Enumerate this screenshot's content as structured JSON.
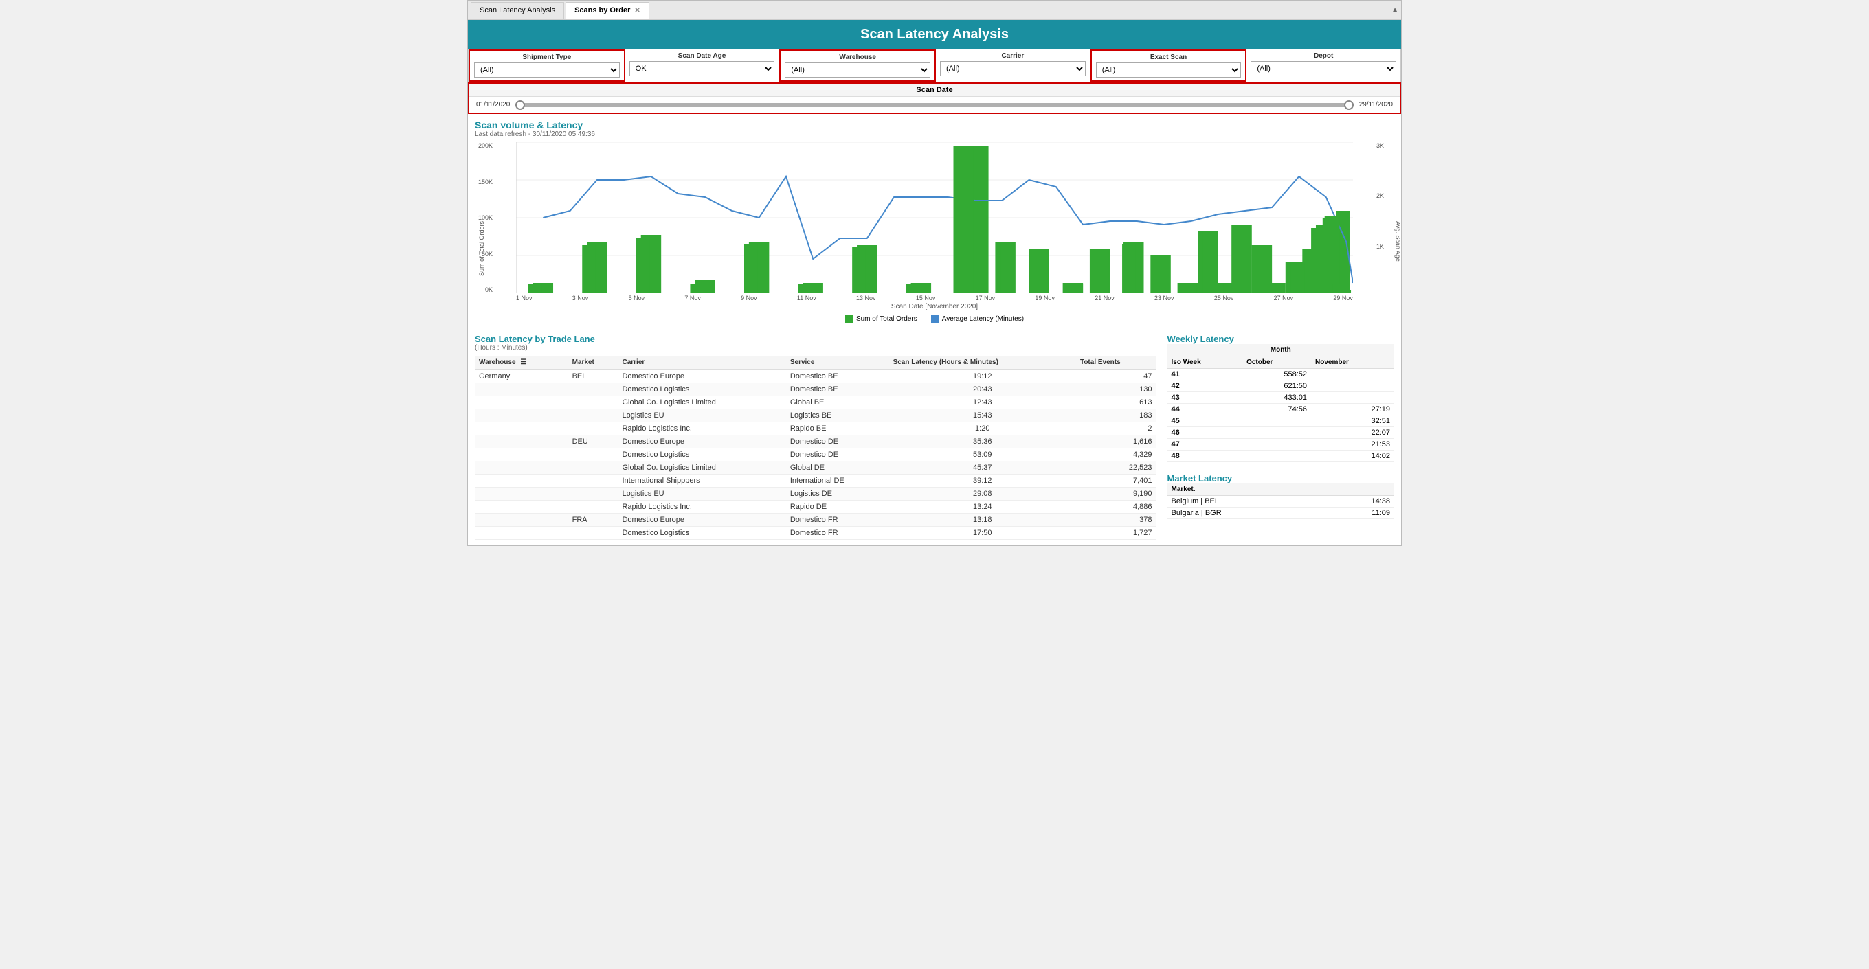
{
  "tabs": {
    "items": [
      {
        "label": "Scan Latency Analysis",
        "active": false
      },
      {
        "label": "Scans by Order",
        "active": true
      }
    ]
  },
  "header": {
    "title": "Scan Latency Analysis"
  },
  "filters": {
    "shipment_type": {
      "label": "Shipment Type",
      "value": "(All)",
      "options": [
        "(All)"
      ]
    },
    "scan_date_age": {
      "label": "Scan Date Age",
      "value": "OK",
      "options": [
        "OK"
      ]
    },
    "warehouse": {
      "label": "Warehouse",
      "value": "(All)",
      "options": [
        "(All)"
      ]
    },
    "carrier": {
      "label": "Carrier",
      "value": "(All)",
      "options": [
        "(All)"
      ]
    },
    "exact_scan": {
      "label": "Exact Scan",
      "value": "(All)",
      "options": [
        "(All)"
      ]
    },
    "depot": {
      "label": "Depot",
      "value": "(All)",
      "options": [
        "(All)"
      ]
    }
  },
  "scan_date": {
    "label": "Scan Date",
    "start": "01/11/2020",
    "end": "29/11/2020"
  },
  "chart": {
    "title": "Scan volume & Latency",
    "subtitle": "Last data refresh - 30/11/2020 05:49:36",
    "x_axis_title": "Scan Date [November 2020]",
    "y_left_label": "Sum of Total Orders",
    "y_right_label": "Avg. Scan Age",
    "y_left": [
      "200K",
      "150K",
      "100K",
      "50K",
      "0K"
    ],
    "y_right": [
      "3K",
      "2K",
      "1K",
      ""
    ],
    "x_labels": [
      "1 Nov",
      "3 Nov",
      "5 Nov",
      "7 Nov",
      "9 Nov",
      "11 Nov",
      "13 Nov",
      "15 Nov",
      "17 Nov",
      "19 Nov",
      "21 Nov",
      "23 Nov",
      "25 Nov",
      "27 Nov",
      "29 Nov"
    ],
    "legend": {
      "bar": "Sum of Total Orders",
      "line": "Average Latency (Minutes)"
    }
  },
  "trade_lane": {
    "title": "Scan Latency by Trade Lane",
    "subtitle": "(Hours : Minutes)",
    "columns": [
      "Warehouse",
      "Market",
      "Carrier",
      "Service",
      "Scan Latency (Hours & Minutes)",
      "Total Events"
    ],
    "rows": [
      {
        "warehouse": "Germany",
        "market": "BEL",
        "carrier": "Domestico Europe",
        "service": "Domestico BE",
        "latency": "19:12",
        "events": "47"
      },
      {
        "warehouse": "",
        "market": "",
        "carrier": "Domestico Logistics",
        "service": "Domestico BE",
        "latency": "20:43",
        "events": "130"
      },
      {
        "warehouse": "",
        "market": "",
        "carrier": "Global Co. Logistics Limited",
        "service": "Global BE",
        "latency": "12:43",
        "events": "613"
      },
      {
        "warehouse": "",
        "market": "",
        "carrier": "Logistics EU",
        "service": "Logistics BE",
        "latency": "15:43",
        "events": "183"
      },
      {
        "warehouse": "",
        "market": "",
        "carrier": "Rapido Logistics Inc.",
        "service": "Rapido BE",
        "latency": "1:20",
        "events": "2"
      },
      {
        "warehouse": "",
        "market": "DEU",
        "carrier": "Domestico Europe",
        "service": "Domestico DE",
        "latency": "35:36",
        "events": "1,616"
      },
      {
        "warehouse": "",
        "market": "",
        "carrier": "Domestico Logistics",
        "service": "Domestico DE",
        "latency": "53:09",
        "events": "4,329"
      },
      {
        "warehouse": "",
        "market": "",
        "carrier": "Global Co. Logistics Limited",
        "service": "Global DE",
        "latency": "45:37",
        "events": "22,523"
      },
      {
        "warehouse": "",
        "market": "",
        "carrier": "International Shipppers",
        "service": "International DE",
        "latency": "39:12",
        "events": "7,401"
      },
      {
        "warehouse": "",
        "market": "",
        "carrier": "Logistics EU",
        "service": "Logistics DE",
        "latency": "29:08",
        "events": "9,190"
      },
      {
        "warehouse": "",
        "market": "",
        "carrier": "Rapido Logistics Inc.",
        "service": "Rapido DE",
        "latency": "13:24",
        "events": "4,886"
      },
      {
        "warehouse": "",
        "market": "FRA",
        "carrier": "Domestico Europe",
        "service": "Domestico FR",
        "latency": "13:18",
        "events": "378"
      },
      {
        "warehouse": "",
        "market": "",
        "carrier": "Domestico Logistics",
        "service": "Domestico FR",
        "latency": "17:50",
        "events": "1,727"
      }
    ]
  },
  "weekly_latency": {
    "title": "Weekly Latency",
    "month_header": "Month",
    "columns": [
      "Iso Week",
      "October",
      "November"
    ],
    "rows": [
      {
        "week": "41",
        "october": "558:52",
        "november": ""
      },
      {
        "week": "42",
        "october": "621:50",
        "november": ""
      },
      {
        "week": "43",
        "october": "433:01",
        "november": ""
      },
      {
        "week": "44",
        "october": "74:56",
        "november": "27:19"
      },
      {
        "week": "45",
        "october": "",
        "november": "32:51"
      },
      {
        "week": "46",
        "october": "",
        "november": "22:07"
      },
      {
        "week": "47",
        "october": "",
        "november": "21:53"
      },
      {
        "week": "48",
        "october": "",
        "november": "14:02"
      }
    ]
  },
  "market_latency": {
    "title": "Market Latency",
    "columns": [
      "Market.",
      ""
    ],
    "rows": [
      {
        "market": "Belgium | BEL",
        "value": "14:38"
      },
      {
        "market": "Bulgaria | BGR",
        "value": "11:09"
      }
    ]
  }
}
